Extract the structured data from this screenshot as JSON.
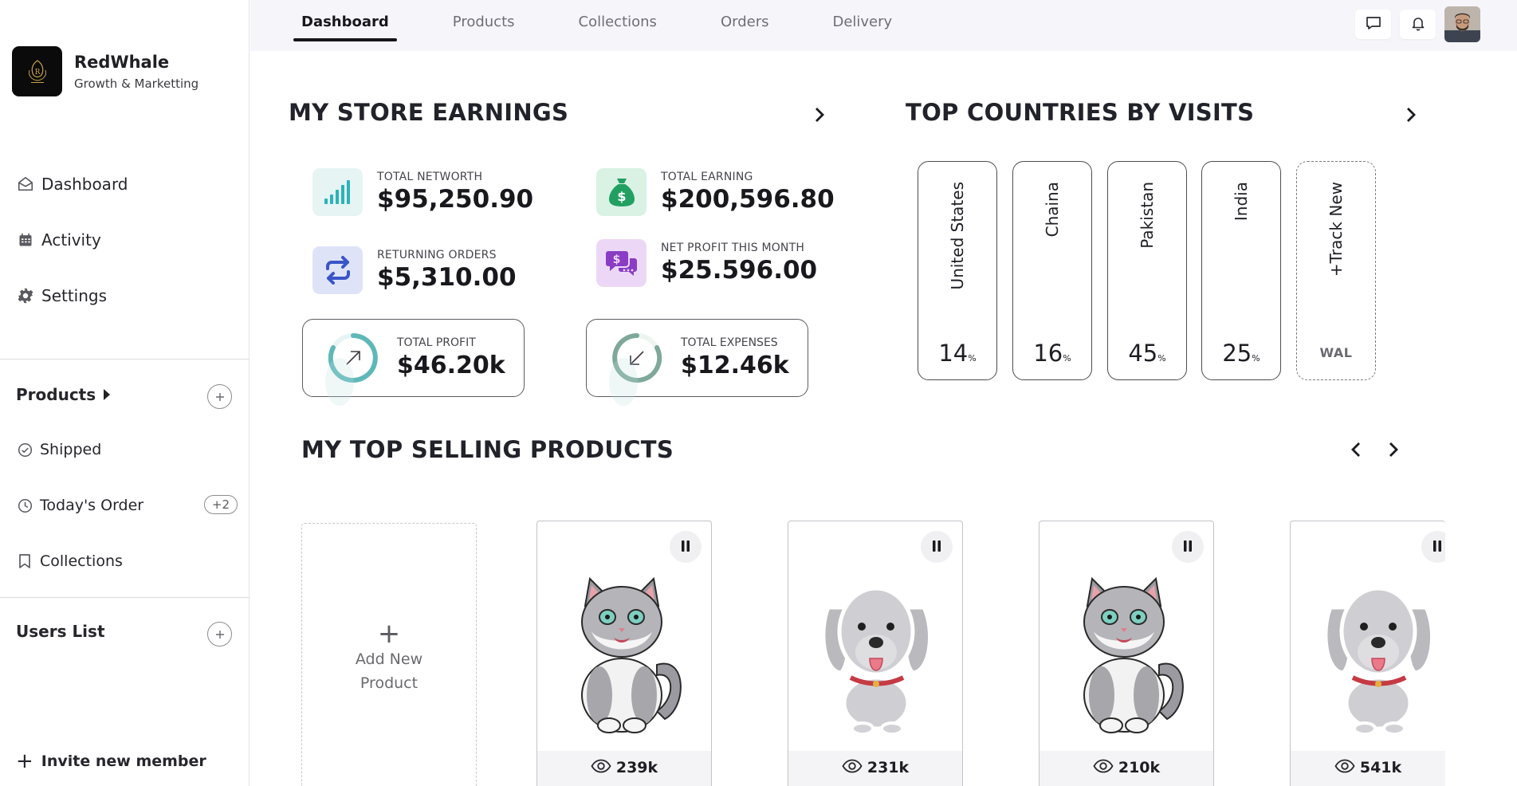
{
  "brand": {
    "name": "RedWhale",
    "subtitle": "Growth & Marketting",
    "logo_icon": "crown-logo-icon"
  },
  "sidebar": {
    "nav": [
      {
        "label": "Dashboard",
        "icon": "inbox-icon"
      },
      {
        "label": "Activity",
        "icon": "calendar-icon"
      },
      {
        "label": "Settings",
        "icon": "gear-icon"
      }
    ],
    "products_section": {
      "title": "Products",
      "items": [
        {
          "label": "Shipped",
          "icon": "check-circle-icon"
        },
        {
          "label": "Today's Order",
          "icon": "clock-icon",
          "badge": "+2"
        },
        {
          "label": "Collections",
          "icon": "bookmark-icon"
        }
      ]
    },
    "users_section": {
      "title": "Users List"
    },
    "invite": {
      "label": "Invite new member",
      "plus": "+"
    }
  },
  "topbar": {
    "tabs": [
      "Dashboard",
      "Products",
      "Collections",
      "Orders",
      "Delivery"
    ],
    "active_tab": "Dashboard",
    "icons": [
      "chat-icon",
      "bell-icon",
      "avatar"
    ]
  },
  "earnings": {
    "title": "MY STORE EARNINGS",
    "stats": [
      {
        "label": "TOTAL NETWORTH",
        "value": "$95,250.90",
        "icon": "signal-bars-icon",
        "color": "#e6f4f4"
      },
      {
        "label": "TOTAL EARNING",
        "value": "$200,596.80",
        "icon": "money-bag-icon",
        "color": "#d9f2e4"
      },
      {
        "label": "RETURNING ORDERS",
        "value": "$5,310.00",
        "icon": "repeat-icon",
        "color": "#dfe3f8"
      },
      {
        "label": "NET PROFIT THIS MONTH",
        "value": "$25.596.00",
        "icon": "chat-dollar-icon",
        "color": "#ecd8f6"
      }
    ],
    "profit": {
      "label": "TOTAL PROFIT",
      "value": "$46.20k",
      "icon": "arrow-up-right-icon"
    },
    "expenses": {
      "label": "TOTAL EXPENSES",
      "value": "$12.46k",
      "icon": "arrow-down-left-icon"
    }
  },
  "countries": {
    "title": "TOP COUNTRIES BY VISITS",
    "items": [
      {
        "name": "United States",
        "pct": "14"
      },
      {
        "name": "Chaina",
        "pct": "16"
      },
      {
        "name": "Pakistan",
        "pct": "45"
      },
      {
        "name": "India",
        "pct": "25"
      }
    ],
    "percent_sign": "%",
    "track_new": {
      "label": "+Track New",
      "code": "WAL"
    }
  },
  "top_products": {
    "title": "MY TOP SELLING PRODUCTS",
    "add_card": {
      "plus": "+",
      "label": "Add New Product"
    },
    "items": [
      {
        "kind": "cat",
        "views": "239k"
      },
      {
        "kind": "dog",
        "views": "231k"
      },
      {
        "kind": "cat",
        "views": "210k"
      },
      {
        "kind": "dog",
        "views": "541k"
      }
    ]
  },
  "colors": {
    "accent_teal": "#4bb5b5",
    "accent_green": "#22a061",
    "accent_blue": "#3a55c8",
    "accent_purple": "#8a3cc4"
  }
}
